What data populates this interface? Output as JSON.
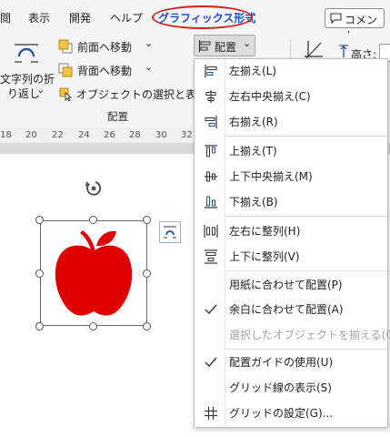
{
  "tabs": [
    {
      "label": "閲"
    },
    {
      "label": "表示"
    },
    {
      "label": "開発"
    },
    {
      "label": "ヘルプ"
    },
    {
      "label": "グラフィックス形式"
    }
  ],
  "comment_button": {
    "label": "コメント"
  },
  "ribbon": {
    "wrap_text": {
      "line1": "文字列の折",
      "line2": "り返し",
      "chevron": "⌄"
    },
    "bring_forward": {
      "label": "前面へ移動",
      "chevron": "⌄"
    },
    "send_backward": {
      "label": "背面へ移動",
      "chevron": "⌄"
    },
    "selection_pane": {
      "label": "オブジェクトの選択と表示"
    },
    "align_button": {
      "label": "配置",
      "chevron": "⌄"
    },
    "height_label": "高さ:",
    "group_caption": "配置"
  },
  "ruler": {
    "numbers": [
      "18",
      "20",
      "22",
      "24",
      "26",
      "28",
      "30",
      "32"
    ]
  },
  "shape": {
    "fill_color": "#e00000",
    "name": "apple-shape"
  },
  "menu": {
    "items": [
      {
        "label": "左揃え(L)",
        "icon": "align-left-icon",
        "disabled": false
      },
      {
        "label": "左右中央揃え(C)",
        "icon": "align-center-icon",
        "disabled": false
      },
      {
        "label": "右揃え(R)",
        "icon": "align-right-icon",
        "disabled": false
      },
      {
        "label": "上揃え(T)",
        "icon": "align-top-icon",
        "disabled": false
      },
      {
        "label": "上下中央揃え(M)",
        "icon": "align-middle-icon",
        "disabled": false
      },
      {
        "label": "下揃え(B)",
        "icon": "align-bottom-icon",
        "disabled": false
      },
      {
        "label": "左右に整列(H)",
        "icon": "distribute-horizontal-icon",
        "disabled": false
      },
      {
        "label": "上下に整列(V)",
        "icon": "distribute-vertical-icon",
        "disabled": false
      },
      {
        "label": "用紙に合わせて配置(P)",
        "icon": "",
        "disabled": false,
        "checked": false
      },
      {
        "label": "余白に合わせて配置(A)",
        "icon": "check-icon",
        "disabled": false,
        "checked": true
      },
      {
        "label": "選択したオブジェクトを揃える(O)",
        "icon": "",
        "disabled": true,
        "checked": false
      },
      {
        "label": "配置ガイドの使用(U)",
        "icon": "check-icon",
        "disabled": false,
        "checked": true
      },
      {
        "label": "グリッド線の表示(S)",
        "icon": "",
        "disabled": false
      },
      {
        "label": "グリッドの設定(G)...",
        "icon": "grid-icon",
        "disabled": false
      }
    ]
  }
}
